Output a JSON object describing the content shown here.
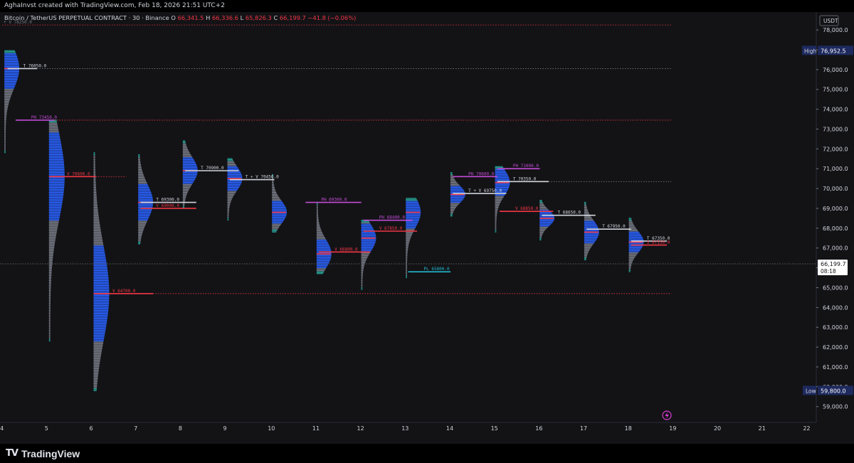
{
  "attribution": "AghaInvst created with TradingView.com, Feb 18, 2026 21:51 UTC+2",
  "brand": "TradingView",
  "legend": {
    "symbol": "Bitcoin / TetherUS PERPETUAL CONTRACT · 30 · Binance",
    "o_label": "O",
    "o_value": "66,341.5",
    "h_label": "H",
    "h_value": "66,336.6",
    "l_label": "L",
    "l_value": "65,826.3",
    "c_label": "C",
    "c_value": "66,199.7",
    "change": "−41.8 (−0.06%)",
    "value_color": "#f23645"
  },
  "scale": {
    "currency": "USDT",
    "high_label": "High",
    "high_value": "76,952.5",
    "low_label": "Low",
    "low_value": "59,800.0",
    "last_price": "66,199.7",
    "countdown": "08:18",
    "colors": {
      "high_badge": "#1e2a5e",
      "price_line": "#787b86"
    }
  },
  "settings_icon": "lightning-icon",
  "colors": {
    "profile_blue": "#2962ff",
    "profile_gray": "#787b86",
    "profile_cyan": "#26a69a",
    "poc_red": "#f23645",
    "ph_magenta": "#c34bd6",
    "level_white": "#d1d4dc",
    "pl_cyan": "#22b8cf"
  },
  "chart_data": {
    "type": "volume-profile",
    "title": "Bitcoin / TetherUS PERPETUAL CONTRACT · 30 · Binance",
    "ylim": [
      58200,
      78900
    ],
    "xlim": [
      3.95,
      22.25
    ],
    "y_ticks": [
      59000,
      60000,
      61000,
      62000,
      63000,
      64000,
      65000,
      66000,
      67000,
      68000,
      69000,
      70000,
      71000,
      72000,
      73000,
      74000,
      75000,
      76000,
      77000,
      78000
    ],
    "y_tick_labels": [
      "59,000.0",
      "60,000.0",
      "61,000.0",
      "62,000.0",
      "63,000.0",
      "64,000.0",
      "65,000.0",
      "66,000.0",
      "67,000.0",
      "68,000.0",
      "69,000.0",
      "70,000.0",
      "71,000.0",
      "72,000.0",
      "73,000.0",
      "74,000.0",
      "75,000.0",
      "76,000.0",
      "77,000.0",
      "78,000.0"
    ],
    "x_ticks": [
      4,
      5,
      6,
      7,
      8,
      9,
      10,
      11,
      12,
      13,
      14,
      15,
      16,
      17,
      18,
      19,
      20,
      21,
      22
    ],
    "x_tick_labels": [
      "4",
      "5",
      "6",
      "7",
      "8",
      "9",
      "10",
      "11",
      "12",
      "13",
      "14",
      "15",
      "16",
      "17",
      "18",
      "19",
      "20",
      "21",
      "22"
    ],
    "sessions": [
      {
        "day": 4,
        "low": 71800,
        "high": 76952.5,
        "poc": 76050,
        "peak": 76050
      },
      {
        "day": 5,
        "low": 62300,
        "high": 73450,
        "poc": 70600,
        "peak": 70600
      },
      {
        "day": 6,
        "low": 59800,
        "high": 71800,
        "poc": 64700,
        "peak": 64700
      },
      {
        "day": 7,
        "low": 67200,
        "high": 71700,
        "poc": 69300,
        "peak": 69300
      },
      {
        "day": 8,
        "low": 69000,
        "high": 72400,
        "poc": 70900,
        "peak": 70900
      },
      {
        "day": 9,
        "low": 68400,
        "high": 71500,
        "poc": 70500,
        "peak": 70500
      },
      {
        "day": 10,
        "low": 67800,
        "high": 70700,
        "poc": 68800,
        "peak": 68800
      },
      {
        "day": 11,
        "low": 65700,
        "high": 69300,
        "poc": 66700,
        "peak": 66700
      },
      {
        "day": 12,
        "low": 64900,
        "high": 68400,
        "poc": 67500,
        "peak": 67500
      },
      {
        "day": 13,
        "low": 65500,
        "high": 69500,
        "poc": 68800,
        "peak": 68800
      },
      {
        "day": 14,
        "low": 68600,
        "high": 70800,
        "poc": 69700,
        "peak": 69700
      },
      {
        "day": 15,
        "low": 67800,
        "high": 71100,
        "poc": 70300,
        "peak": 70300
      },
      {
        "day": 16,
        "low": 67400,
        "high": 69400,
        "poc": 68500,
        "peak": 68500
      },
      {
        "day": 17,
        "low": 66400,
        "high": 69300,
        "poc": 67800,
        "peak": 67800
      },
      {
        "day": 18,
        "low": 65800,
        "high": 68500,
        "poc": 67300,
        "peak": 67300
      }
    ],
    "levels": [
      {
        "label": "+ V 78250.0",
        "price": 78250,
        "x0": 4.0,
        "x1": 19.0,
        "color": "#f23645",
        "style": "dotted",
        "text_color": "#787b86"
      },
      {
        "label": "T 76050.0",
        "price": 76050,
        "x0": 4.12,
        "x1": 4.78,
        "color": "#d1d4dc",
        "style": "solid",
        "text_color": "#d1d4dc"
      },
      {
        "label": "",
        "price": 76050,
        "x0": 4.78,
        "x1": 19.0,
        "color": "#787b86",
        "style": "dotted",
        "text_color": "#787b86"
      },
      {
        "label": "PH 73450.0",
        "price": 73450,
        "x0": 4.3,
        "x1": 5.17,
        "color": "#c34bd6",
        "style": "solid",
        "text_color": "#c34bd6"
      },
      {
        "label": "",
        "price": 73450,
        "x0": 5.17,
        "x1": 19.0,
        "color": "#f23645",
        "style": "dotted",
        "text_color": "#787b86"
      },
      {
        "label": "V 70600.0",
        "price": 70600,
        "x0": 5.1,
        "x1": 6.1,
        "color": "#f23645",
        "style": "solid",
        "text_color": "#f23645"
      },
      {
        "label": "",
        "price": 70600,
        "x0": 6.1,
        "x1": 6.78,
        "color": "#f23645",
        "style": "dotted",
        "text_color": "#787b86"
      },
      {
        "label": "V 64700.0",
        "price": 64700,
        "x0": 6.12,
        "x1": 7.38,
        "color": "#f23645",
        "style": "solid",
        "text_color": "#f23645"
      },
      {
        "label": "",
        "price": 64700,
        "x0": 7.38,
        "x1": 19.0,
        "color": "#f23645",
        "style": "dotted",
        "text_color": "#787b86"
      },
      {
        "label": "T 69300.0",
        "price": 69300,
        "x0": 7.1,
        "x1": 8.35,
        "color": "#d1d4dc",
        "style": "solid",
        "text_color": "#d1d4dc"
      },
      {
        "label": "V 69000.0",
        "price": 69000,
        "x0": 7.1,
        "x1": 8.35,
        "color": "#f23645",
        "style": "solid",
        "text_color": "#f23645"
      },
      {
        "label": "T 70900.0",
        "price": 70900,
        "x0": 8.1,
        "x1": 9.3,
        "color": "#d1d4dc",
        "style": "solid",
        "text_color": "#d1d4dc"
      },
      {
        "label": "T + V 70450.0",
        "price": 70450,
        "x0": 9.1,
        "x1": 10.1,
        "color": "#d1d4dc",
        "style": "solid",
        "text_color": "#d1d4dc"
      },
      {
        "label": "PH 69300.0",
        "price": 69300,
        "x0": 10.8,
        "x1": 12.05,
        "color": "#c34bd6",
        "style": "solid",
        "text_color": "#c34bd6"
      },
      {
        "label": "V 66800.0",
        "price": 66800,
        "x0": 11.1,
        "x1": 12.25,
        "color": "#f23645",
        "style": "solid",
        "text_color": "#f23645"
      },
      {
        "label": "PH 68400.0",
        "price": 68400,
        "x0": 12.1,
        "x1": 13.2,
        "color": "#c34bd6",
        "style": "solid",
        "text_color": "#c34bd6"
      },
      {
        "label": "V 67850.0",
        "price": 67850,
        "x0": 12.1,
        "x1": 13.3,
        "color": "#f23645",
        "style": "solid",
        "text_color": "#f23645"
      },
      {
        "label": "PL 65800.0",
        "price": 65800,
        "x0": 13.1,
        "x1": 14.05,
        "color": "#22b8cf",
        "style": "solid",
        "text_color": "#22b8cf"
      },
      {
        "label": "PH 70600.0",
        "price": 70600,
        "x0": 14.1,
        "x1": 15.1,
        "color": "#c34bd6",
        "style": "solid",
        "text_color": "#c34bd6"
      },
      {
        "label": "T + V 69750.0",
        "price": 69750,
        "x0": 14.1,
        "x1": 15.3,
        "color": "#d1d4dc",
        "style": "solid",
        "text_color": "#d1d4dc"
      },
      {
        "label": "PH 71000.0",
        "price": 71000,
        "x0": 15.1,
        "x1": 16.05,
        "color": "#c34bd6",
        "style": "solid",
        "text_color": "#c34bd6"
      },
      {
        "label": "T 70350.0",
        "price": 70350,
        "x0": 15.1,
        "x1": 16.25,
        "color": "#d1d4dc",
        "style": "solid",
        "text_color": "#d1d4dc"
      },
      {
        "label": "",
        "price": 70350,
        "x0": 16.25,
        "x1": 19.0,
        "color": "#787b86",
        "style": "dotted",
        "text_color": "#787b86"
      },
      {
        "label": "V 68850.0",
        "price": 68850,
        "x0": 15.15,
        "x1": 16.35,
        "color": "#f23645",
        "style": "solid",
        "text_color": "#f23645"
      },
      {
        "label": "T 68650.0",
        "price": 68650,
        "x0": 16.1,
        "x1": 17.3,
        "color": "#d1d4dc",
        "style": "solid",
        "text_color": "#d1d4dc"
      },
      {
        "label": "T 67950.0",
        "price": 67950,
        "x0": 17.1,
        "x1": 18.1,
        "color": "#d1d4dc",
        "style": "solid",
        "text_color": "#d1d4dc"
      },
      {
        "label": "T 67350.0",
        "price": 67350,
        "x0": 18.1,
        "x1": 18.9,
        "color": "#d1d4dc",
        "style": "solid",
        "text_color": "#d1d4dc"
      },
      {
        "label": "V 67150.0",
        "price": 67150,
        "x0": 18.1,
        "x1": 18.9,
        "color": "#f23645",
        "style": "solid",
        "text_color": "#f23645"
      }
    ],
    "last_price": 66199.7
  }
}
